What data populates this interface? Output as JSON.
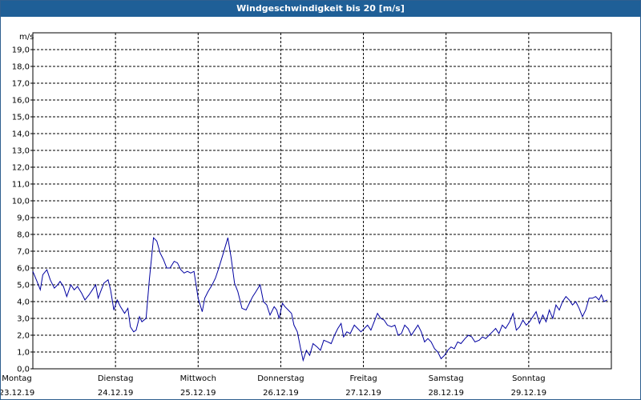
{
  "chart_data": {
    "type": "line",
    "title": "Windgeschwindigkeit bis 20 [m/s]",
    "ylabel": "m/s",
    "ylim": [
      0,
      20
    ],
    "xlim": [
      0,
      7
    ],
    "grid": true,
    "y_ticks": [
      "0,0",
      "1,0",
      "2,0",
      "3,0",
      "4,0",
      "5,0",
      "6,0",
      "7,0",
      "8,0",
      "9,0",
      "10,0",
      "11,0",
      "12,0",
      "13,0",
      "14,0",
      "15,0",
      "16,0",
      "17,0",
      "18,0",
      "19,0"
    ],
    "x_ticks": [
      {
        "x": 0,
        "day": "Montag",
        "date": "23.12.19"
      },
      {
        "x": 1,
        "day": "Dienstag",
        "date": "24.12.19"
      },
      {
        "x": 2,
        "day": "Mittwoch",
        "date": "25.12.19"
      },
      {
        "x": 3,
        "day": "Donnerstag",
        "date": "26.12.19"
      },
      {
        "x": 4,
        "day": "Freitag",
        "date": "27.12.19"
      },
      {
        "x": 5,
        "day": "Samstag",
        "date": "28.12.19"
      },
      {
        "x": 6,
        "day": "Sonntag",
        "date": "29.12.19"
      }
    ],
    "line_color": "#0000a0",
    "series": [
      {
        "values": [
          [
            0.0,
            5.8
          ],
          [
            0.05,
            5.2
          ],
          [
            0.09,
            4.7
          ],
          [
            0.12,
            5.6
          ],
          [
            0.17,
            5.9
          ],
          [
            0.21,
            5.3
          ],
          [
            0.26,
            4.8
          ],
          [
            0.3,
            5.0
          ],
          [
            0.33,
            5.2
          ],
          [
            0.37,
            4.9
          ],
          [
            0.41,
            4.3
          ],
          [
            0.46,
            5.0
          ],
          [
            0.5,
            4.7
          ],
          [
            0.54,
            4.9
          ],
          [
            0.59,
            4.5
          ],
          [
            0.63,
            4.1
          ],
          [
            0.68,
            4.4
          ],
          [
            0.72,
            4.7
          ],
          [
            0.76,
            5.0
          ],
          [
            0.79,
            4.2
          ],
          [
            0.82,
            4.6
          ],
          [
            0.86,
            5.1
          ],
          [
            0.91,
            5.3
          ],
          [
            0.94,
            4.7
          ],
          [
            0.98,
            3.5
          ],
          [
            1.02,
            4.1
          ],
          [
            1.06,
            3.7
          ],
          [
            1.11,
            3.3
          ],
          [
            1.15,
            3.6
          ],
          [
            1.18,
            2.5
          ],
          [
            1.22,
            2.2
          ],
          [
            1.25,
            2.3
          ],
          [
            1.29,
            3.1
          ],
          [
            1.32,
            2.8
          ],
          [
            1.37,
            3.0
          ],
          [
            1.41,
            5.3
          ],
          [
            1.46,
            7.8
          ],
          [
            1.5,
            7.6
          ],
          [
            1.54,
            6.9
          ],
          [
            1.58,
            6.5
          ],
          [
            1.62,
            6.0
          ],
          [
            1.66,
            6.0
          ],
          [
            1.71,
            6.4
          ],
          [
            1.75,
            6.3
          ],
          [
            1.79,
            5.9
          ],
          [
            1.83,
            5.7
          ],
          [
            1.87,
            5.8
          ],
          [
            1.91,
            5.7
          ],
          [
            1.95,
            5.8
          ],
          [
            2.0,
            4.2
          ],
          [
            2.05,
            3.4
          ],
          [
            2.08,
            4.2
          ],
          [
            2.12,
            4.6
          ],
          [
            2.17,
            5.0
          ],
          [
            2.21,
            5.4
          ],
          [
            2.25,
            6.0
          ],
          [
            2.3,
            6.8
          ],
          [
            2.36,
            7.8
          ],
          [
            2.4,
            6.6
          ],
          [
            2.44,
            5.1
          ],
          [
            2.48,
            4.6
          ],
          [
            2.53,
            3.6
          ],
          [
            2.58,
            3.5
          ],
          [
            2.62,
            3.9
          ],
          [
            2.66,
            4.3
          ],
          [
            2.7,
            4.6
          ],
          [
            2.75,
            5.0
          ],
          [
            2.79,
            4.0
          ],
          [
            2.83,
            3.8
          ],
          [
            2.87,
            3.2
          ],
          [
            2.92,
            3.7
          ],
          [
            2.95,
            3.5
          ],
          [
            2.98,
            3.0
          ],
          [
            3.02,
            3.9
          ],
          [
            3.05,
            3.7
          ],
          [
            3.09,
            3.5
          ],
          [
            3.13,
            3.3
          ],
          [
            3.16,
            2.6
          ],
          [
            3.2,
            2.2
          ],
          [
            3.24,
            1.2
          ],
          [
            3.27,
            0.5
          ],
          [
            3.31,
            1.1
          ],
          [
            3.35,
            0.8
          ],
          [
            3.39,
            1.5
          ],
          [
            3.44,
            1.3
          ],
          [
            3.48,
            1.1
          ],
          [
            3.52,
            1.7
          ],
          [
            3.57,
            1.6
          ],
          [
            3.61,
            1.5
          ],
          [
            3.65,
            2.0
          ],
          [
            3.69,
            2.4
          ],
          [
            3.73,
            2.7
          ],
          [
            3.76,
            1.9
          ],
          [
            3.8,
            2.2
          ],
          [
            3.84,
            2.1
          ],
          [
            3.89,
            2.6
          ],
          [
            3.93,
            2.4
          ],
          [
            3.97,
            2.2
          ],
          [
            4.01,
            2.4
          ],
          [
            4.05,
            2.6
          ],
          [
            4.09,
            2.3
          ],
          [
            4.13,
            2.8
          ],
          [
            4.17,
            3.3
          ],
          [
            4.21,
            3.0
          ],
          [
            4.25,
            2.9
          ],
          [
            4.29,
            2.6
          ],
          [
            4.34,
            2.5
          ],
          [
            4.38,
            2.6
          ],
          [
            4.42,
            2.0
          ],
          [
            4.46,
            2.1
          ],
          [
            4.5,
            2.6
          ],
          [
            4.54,
            2.4
          ],
          [
            4.58,
            2.0
          ],
          [
            4.62,
            2.3
          ],
          [
            4.66,
            2.6
          ],
          [
            4.7,
            2.2
          ],
          [
            4.74,
            1.6
          ],
          [
            4.78,
            1.8
          ],
          [
            4.82,
            1.6
          ],
          [
            4.86,
            1.2
          ],
          [
            4.9,
            1.0
          ],
          [
            4.94,
            0.6
          ],
          [
            4.98,
            0.8
          ],
          [
            5.02,
            1.1
          ],
          [
            5.06,
            1.3
          ],
          [
            5.1,
            1.2
          ],
          [
            5.14,
            1.6
          ],
          [
            5.18,
            1.5
          ],
          [
            5.23,
            1.8
          ],
          [
            5.27,
            2.0
          ],
          [
            5.31,
            1.9
          ],
          [
            5.35,
            1.6
          ],
          [
            5.4,
            1.7
          ],
          [
            5.44,
            1.9
          ],
          [
            5.48,
            1.8
          ],
          [
            5.52,
            2.0
          ],
          [
            5.56,
            2.2
          ],
          [
            5.6,
            2.4
          ],
          [
            5.64,
            2.1
          ],
          [
            5.68,
            2.6
          ],
          [
            5.72,
            2.4
          ],
          [
            5.77,
            2.8
          ],
          [
            5.81,
            3.3
          ],
          [
            5.85,
            2.3
          ],
          [
            5.89,
            2.5
          ],
          [
            5.93,
            2.9
          ],
          [
            5.97,
            2.6
          ],
          [
            6.01,
            2.8
          ],
          [
            6.05,
            3.1
          ],
          [
            6.09,
            3.4
          ],
          [
            6.13,
            2.7
          ],
          [
            6.17,
            3.2
          ],
          [
            6.21,
            2.8
          ],
          [
            6.25,
            3.5
          ],
          [
            6.29,
            3.0
          ],
          [
            6.33,
            3.8
          ],
          [
            6.37,
            3.5
          ],
          [
            6.41,
            4.0
          ],
          [
            6.45,
            4.3
          ],
          [
            6.49,
            4.1
          ],
          [
            6.53,
            3.8
          ],
          [
            6.57,
            4.0
          ],
          [
            6.61,
            3.6
          ],
          [
            6.65,
            3.1
          ],
          [
            6.69,
            3.5
          ],
          [
            6.73,
            4.2
          ],
          [
            6.77,
            4.2
          ],
          [
            6.81,
            4.3
          ],
          [
            6.85,
            4.1
          ],
          [
            6.88,
            4.4
          ],
          [
            6.91,
            4.0
          ],
          [
            6.95,
            4.1
          ]
        ]
      }
    ]
  }
}
